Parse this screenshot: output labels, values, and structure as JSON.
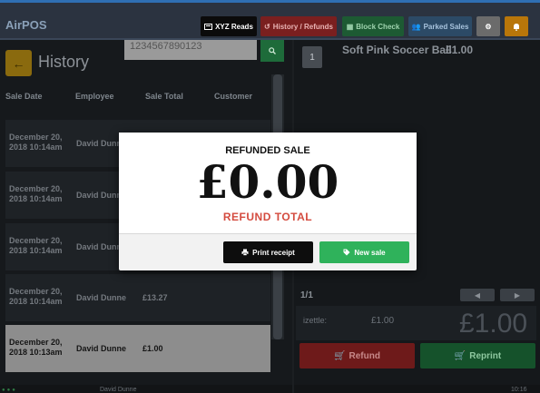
{
  "app": {
    "brand": "AirPOS"
  },
  "toolbar": {
    "xyz_reads": "XYZ Reads",
    "history_refunds": "History / Refunds",
    "block_check": "Block Check",
    "parked_sales": "Parked Sales"
  },
  "history": {
    "title": "History",
    "search_value": "1234567890123",
    "columns": [
      "Sale Date",
      "Employee",
      "Sale Total",
      "Customer"
    ],
    "rows": [
      {
        "date": "December 20, 2018 10:14am",
        "employee": "David Dunne",
        "total": ""
      },
      {
        "date": "December 20, 2018 10:14am",
        "employee": "David Dunne",
        "total": ""
      },
      {
        "date": "December 20, 2018 10:14am",
        "employee": "David Dunne",
        "total": ""
      },
      {
        "date": "December 20, 2018 10:14am",
        "employee": "David Dunne",
        "total": "£13.27"
      },
      {
        "date": "December 20, 2018 10:13am",
        "employee": "David Dunne",
        "total": "£1.00"
      }
    ],
    "footer_user": "David Dunne"
  },
  "sale": {
    "line_items": [
      {
        "qty": "1",
        "name": "Soft Pink Soccer Ball",
        "price": "£1.00"
      }
    ],
    "page": "1/1",
    "payment_method": "izettle:",
    "payment_amount": "£1.00",
    "total": "£1.00",
    "refund_label": "Refund",
    "reprint_label": "Reprint",
    "footer_time": "10:16"
  },
  "modal": {
    "title": "REFUNDED SALE",
    "amount": "£0.00",
    "subtitle": "REFUND TOTAL",
    "print_label": "Print receipt",
    "new_sale_label": "New sale"
  },
  "colors": {
    "refund_red": "#d44b3f",
    "new_sale_green": "#2fb25b",
    "print_black": "#0d0d0d"
  }
}
